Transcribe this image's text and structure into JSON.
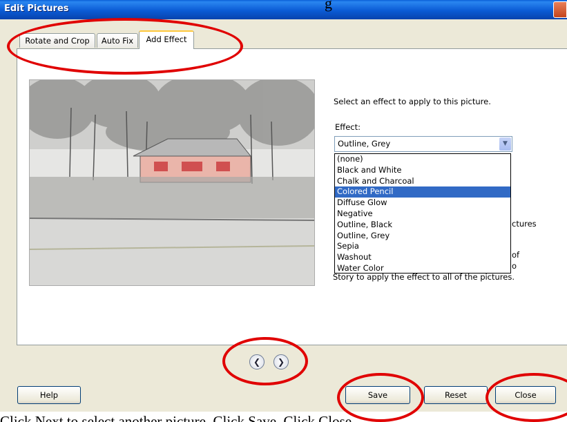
{
  "window": {
    "title": "Edit Pictures"
  },
  "doc_heading": "g",
  "tabs": [
    {
      "label": "Rotate and Crop"
    },
    {
      "label": "Auto Fix"
    },
    {
      "label": "Add Effect"
    }
  ],
  "effects_panel": {
    "instruction": "Select an effect to apply to this picture.",
    "effect_label": "Effect:",
    "selected_value": "Outline, Grey",
    "options": [
      "(none)",
      "Black and White",
      "Chalk and Charcoal",
      "Colored Pencil",
      "Diffuse Glow",
      "Negative",
      "Outline, Black",
      "Outline, Grey",
      "Sepia",
      "Washout",
      "Water Color"
    ],
    "highlighted_option": "Colored Pencil",
    "partial_text_1": "ctures",
    "partial_text_2": "of",
    "partial_text_3": "o",
    "partial_text_4": "Story to apply the effect to all of the pictures."
  },
  "nav": {
    "prev_icon": "chevron-left-icon",
    "next_icon": "chevron-right-icon"
  },
  "buttons": {
    "help": "Help",
    "save": "Save",
    "reset": "Reset",
    "close": "Close"
  },
  "caption": "Click Next to select another picture. Click Save. Click Close.",
  "colors": {
    "annotation_ring": "#e00000",
    "selection": "#316ac5",
    "title_bar": "#0b5bd5"
  }
}
